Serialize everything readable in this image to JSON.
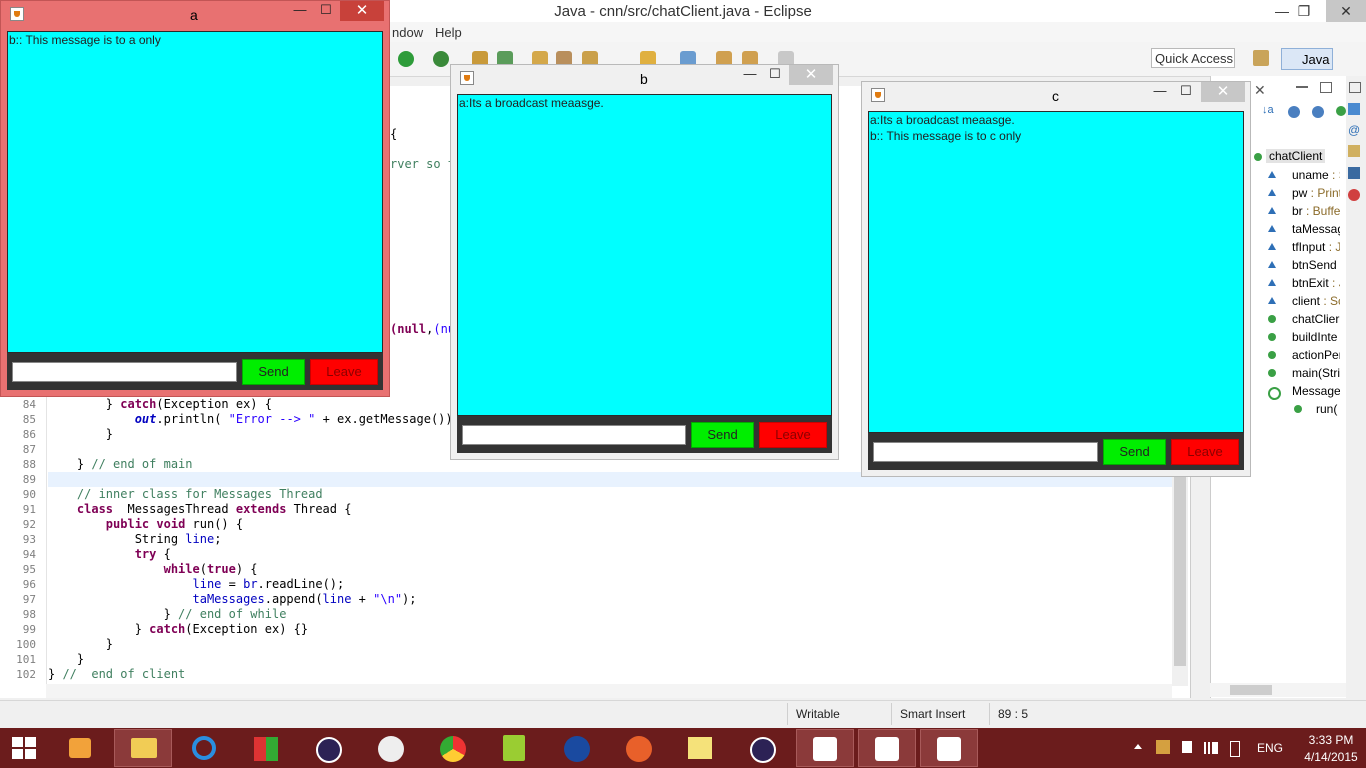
{
  "eclipse": {
    "title": "Java - cnn/src/chatClient.java - Eclipse",
    "menu": [
      "ndow",
      "Help"
    ],
    "quick_access": "Quick Access",
    "perspective": "Java",
    "window_controls": [
      "—",
      "❐",
      "✕"
    ]
  },
  "editor": {
    "lines": [
      {
        "n": "84",
        "segs": [
          {
            "t": "        } "
          },
          {
            "t": "catch",
            "c": "kw"
          },
          {
            "t": "(Exception ex) {"
          }
        ]
      },
      {
        "n": "85",
        "segs": [
          {
            "t": "            "
          },
          {
            "t": "out",
            "c": "sf"
          },
          {
            "t": ".println( "
          },
          {
            "t": "\"Error --> \"",
            "c": "st"
          },
          {
            "t": " + ex.getMessage());"
          }
        ]
      },
      {
        "n": "86",
        "segs": [
          {
            "t": "        }"
          }
        ]
      },
      {
        "n": "87",
        "segs": [
          {
            "t": ""
          }
        ]
      },
      {
        "n": "88",
        "segs": [
          {
            "t": "    } "
          },
          {
            "t": "// end of main",
            "c": "cm"
          }
        ]
      },
      {
        "n": "89",
        "segs": [
          {
            "t": ""
          }
        ]
      },
      {
        "n": "90",
        "segs": [
          {
            "t": "    "
          },
          {
            "t": "// inner class for Messages Thread",
            "c": "cm"
          }
        ]
      },
      {
        "n": "91",
        "segs": [
          {
            "t": "    "
          },
          {
            "t": "class",
            "c": "kw"
          },
          {
            "t": "  MessagesThread "
          },
          {
            "t": "extends",
            "c": "kw"
          },
          {
            "t": " Thread {"
          }
        ]
      },
      {
        "n": "92",
        "segs": [
          {
            "t": "        "
          },
          {
            "t": "public",
            "c": "kw"
          },
          {
            "t": " "
          },
          {
            "t": "void",
            "c": "kw"
          },
          {
            "t": " run() {"
          }
        ]
      },
      {
        "n": "93",
        "segs": [
          {
            "t": "            String "
          },
          {
            "t": "line",
            "c": "fi"
          },
          {
            "t": ";"
          }
        ]
      },
      {
        "n": "94",
        "segs": [
          {
            "t": "            "
          },
          {
            "t": "try",
            "c": "kw"
          },
          {
            "t": " {"
          }
        ]
      },
      {
        "n": "95",
        "segs": [
          {
            "t": "                "
          },
          {
            "t": "while",
            "c": "kw"
          },
          {
            "t": "("
          },
          {
            "t": "true",
            "c": "kw"
          },
          {
            "t": ") {"
          }
        ]
      },
      {
        "n": "96",
        "segs": [
          {
            "t": "                    "
          },
          {
            "t": "line",
            "c": "fi"
          },
          {
            "t": " = "
          },
          {
            "t": "br",
            "c": "fi"
          },
          {
            "t": ".readLine();"
          }
        ]
      },
      {
        "n": "97",
        "segs": [
          {
            "t": "                    "
          },
          {
            "t": "taMessages",
            "c": "fi"
          },
          {
            "t": ".append("
          },
          {
            "t": "line",
            "c": "fi"
          },
          {
            "t": " + "
          },
          {
            "t": "\"\\n\"",
            "c": "st"
          },
          {
            "t": ");"
          }
        ]
      },
      {
        "n": "98",
        "segs": [
          {
            "t": "                } "
          },
          {
            "t": "// end of while",
            "c": "cm"
          }
        ]
      },
      {
        "n": "99",
        "segs": [
          {
            "t": "            } "
          },
          {
            "t": "catch",
            "c": "kw"
          },
          {
            "t": "(Exception ex) {}"
          }
        ]
      },
      {
        "n": "100",
        "segs": [
          {
            "t": "        }"
          }
        ]
      },
      {
        "n": "101",
        "segs": [
          {
            "t": "    }"
          }
        ]
      },
      {
        "n": "102",
        "segs": [
          {
            "t": "} "
          },
          {
            "t": "//  end of client",
            "c": "cm"
          }
        ]
      }
    ],
    "fragments": {
      "brace": "{",
      "server": "rver so t",
      "joption": "(null,\"C"
    }
  },
  "outline": {
    "root": "chatClient",
    "items": [
      {
        "name": "uname",
        "type": " : S",
        "icon": "field-icon"
      },
      {
        "name": "pw",
        "type": " : Print",
        "icon": "field-icon"
      },
      {
        "name": "br",
        "type": " : Buffe",
        "icon": "field-icon"
      },
      {
        "name": "taMessag",
        "type": "",
        "icon": "field-icon"
      },
      {
        "name": "tfInput",
        "type": " : J",
        "icon": "field-icon"
      },
      {
        "name": "btnSend",
        "type": "",
        "icon": "field-icon"
      },
      {
        "name": "btnExit",
        "type": " : J",
        "icon": "field-icon"
      },
      {
        "name": "client",
        "type": " : Sc",
        "icon": "field-icon"
      },
      {
        "name": "chatClier",
        "type": "",
        "icon": "constructor-icon"
      },
      {
        "name": "buildInte",
        "type": "",
        "icon": "method-icon"
      },
      {
        "name": "actionPer",
        "type": "",
        "icon": "method-icon"
      },
      {
        "name": "main(Stri",
        "type": "",
        "icon": "method-icon"
      },
      {
        "name": "Messages",
        "type": "",
        "icon": "class-icon"
      },
      {
        "name": "run(",
        "type": "",
        "icon": "method-icon"
      }
    ]
  },
  "status": {
    "writable": "Writable",
    "insert": "Smart Insert",
    "position": "89 : 5"
  },
  "taskbar": {
    "time": "3:33 PM",
    "date": "4/14/2015",
    "lang": "ENG"
  },
  "chat_windows": {
    "a": {
      "title": "a",
      "messages": [
        "b:: This message is to a only"
      ],
      "send": "Send",
      "leave": "Leave"
    },
    "b": {
      "title": "b",
      "messages": [
        "a:Its a broadcast meaasge."
      ],
      "send": "Send",
      "leave": "Leave"
    },
    "c": {
      "title": "c",
      "messages": [
        "a:Its a broadcast meaasge.",
        "b:: This message is to c only"
      ],
      "send": "Send",
      "leave": "Leave"
    }
  },
  "colors": {
    "chat_bg": "#00ffff",
    "send": "#00ee00",
    "leave": "#ff0000",
    "active_frame": "#e87171",
    "taskbar": "#6b1c1c"
  }
}
